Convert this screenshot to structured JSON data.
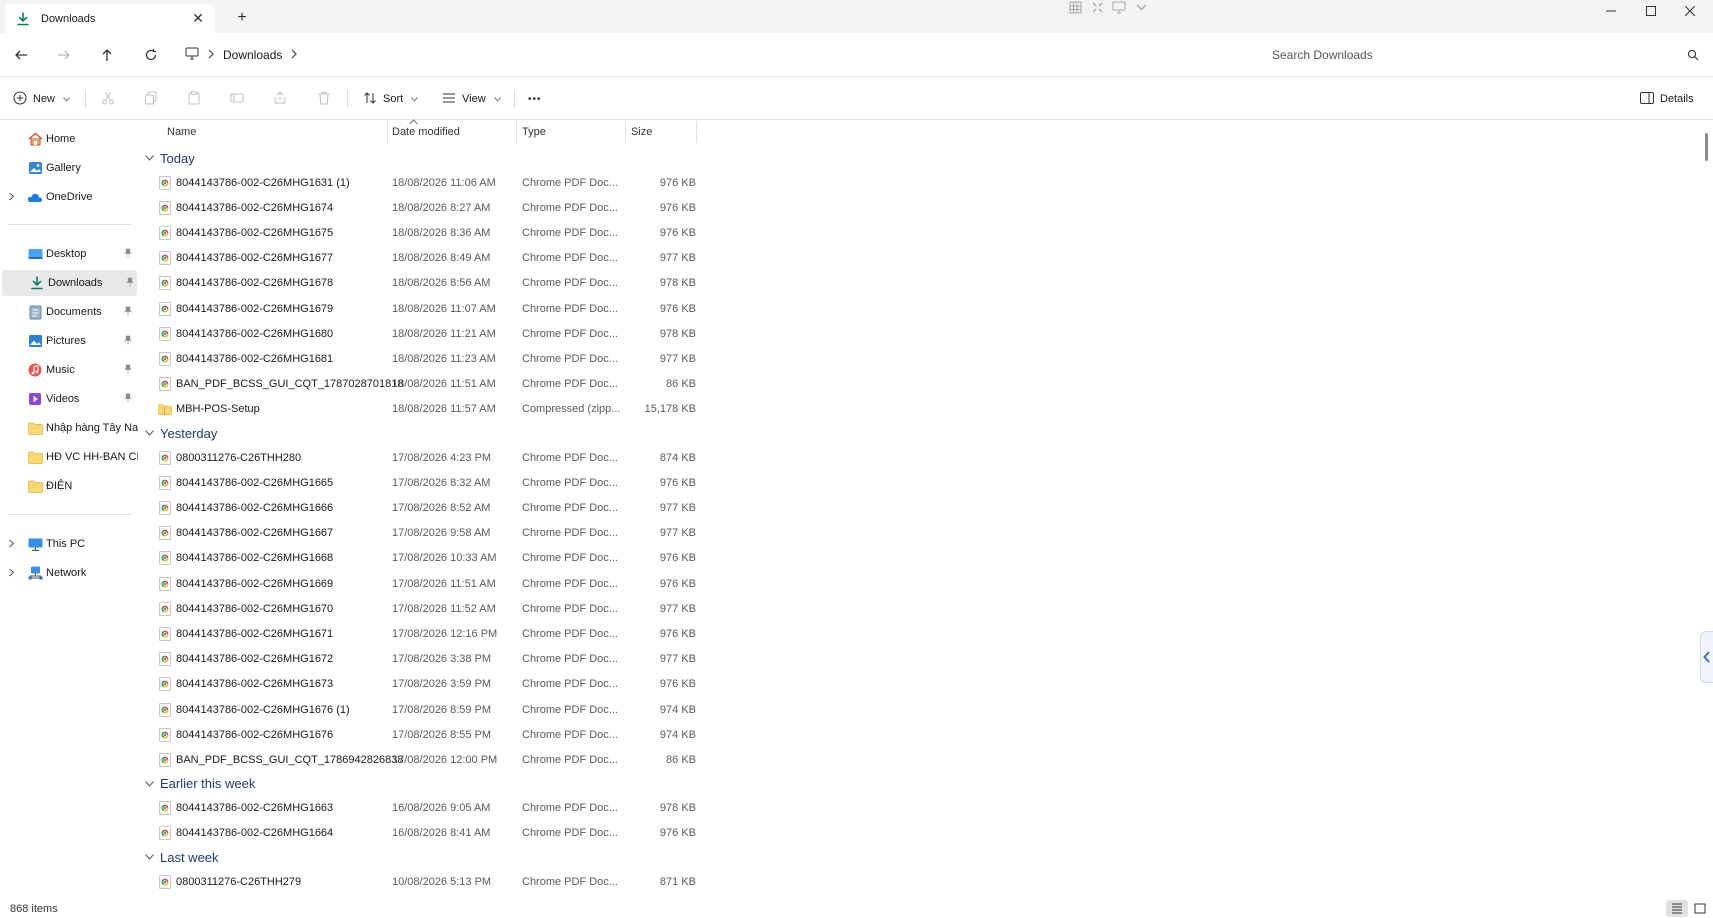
{
  "tab": {
    "icon": "download-icon",
    "title": "Downloads",
    "close": "✕",
    "new_tab": "+"
  },
  "window": {
    "minimize": "—",
    "maximize": "☐",
    "close": "✕"
  },
  "address": {
    "breadcrumbs": [
      "Downloads"
    ],
    "search_placeholder": "Search Downloads"
  },
  "toolbar": {
    "new_label": "New",
    "sort_label": "Sort",
    "view_label": "View",
    "more_label": "•••",
    "details_label": "Details"
  },
  "sidebar": {
    "quick": [
      {
        "label": "Home",
        "icon": "home-icon"
      },
      {
        "label": "Gallery",
        "icon": "gallery-icon"
      },
      {
        "label": "OneDrive",
        "icon": "onedrive-icon"
      }
    ],
    "pinned": [
      {
        "label": "Desktop",
        "icon": "desktop-folder-icon"
      },
      {
        "label": "Downloads",
        "icon": "downloads-folder-icon"
      },
      {
        "label": "Documents",
        "icon": "documents-folder-icon"
      },
      {
        "label": "Pictures",
        "icon": "pictures-folder-icon"
      },
      {
        "label": "Music",
        "icon": "music-folder-icon"
      },
      {
        "label": "Videos",
        "icon": "videos-folder-icon"
      },
      {
        "label": "Nhập hàng Tây Nam",
        "icon": "folder-icon"
      },
      {
        "label": "HĐ VC HH-BAN CHỈ",
        "icon": "folder-icon"
      },
      {
        "label": "ĐIỆN",
        "icon": "folder-icon"
      }
    ],
    "devices": [
      {
        "label": "This PC",
        "icon": "pc-icon"
      },
      {
        "label": "Network",
        "icon": "network-icon"
      }
    ]
  },
  "columns": {
    "name": "Name",
    "date": "Date modified",
    "type": "Type",
    "size": "Size"
  },
  "groups": [
    {
      "label": "Today",
      "rows": [
        {
          "name": "8044143786-002-C26MHG1631 (1)",
          "date": "18/08/2026 11:06 AM",
          "type": "Chrome PDF Doc...",
          "size": "976 KB",
          "icon": "chrome-pdf-icon"
        },
        {
          "name": "8044143786-002-C26MHG1674",
          "date": "18/08/2026 8:27 AM",
          "type": "Chrome PDF Doc...",
          "size": "976 KB",
          "icon": "chrome-pdf-icon"
        },
        {
          "name": "8044143786-002-C26MHG1675",
          "date": "18/08/2026 8:36 AM",
          "type": "Chrome PDF Doc...",
          "size": "976 KB",
          "icon": "chrome-pdf-icon"
        },
        {
          "name": "8044143786-002-C26MHG1677",
          "date": "18/08/2026 8:49 AM",
          "type": "Chrome PDF Doc...",
          "size": "977 KB",
          "icon": "chrome-pdf-icon"
        },
        {
          "name": "8044143786-002-C26MHG1678",
          "date": "18/08/2026 8:56 AM",
          "type": "Chrome PDF Doc...",
          "size": "978 KB",
          "icon": "chrome-pdf-icon"
        },
        {
          "name": "8044143786-002-C26MHG1679",
          "date": "18/08/2026 11:07 AM",
          "type": "Chrome PDF Doc...",
          "size": "976 KB",
          "icon": "chrome-pdf-icon"
        },
        {
          "name": "8044143786-002-C26MHG1680",
          "date": "18/08/2026 11:21 AM",
          "type": "Chrome PDF Doc...",
          "size": "978 KB",
          "icon": "chrome-pdf-icon"
        },
        {
          "name": "8044143786-002-C26MHG1681",
          "date": "18/08/2026 11:23 AM",
          "type": "Chrome PDF Doc...",
          "size": "977 KB",
          "icon": "chrome-pdf-icon"
        },
        {
          "name": "BAN_PDF_BCSS_GUI_CQT_1787028701818",
          "date": "18/08/2026 11:51 AM",
          "type": "Chrome PDF Doc...",
          "size": "86 KB",
          "icon": "chrome-pdf-icon"
        },
        {
          "name": "MBH-POS-Setup",
          "date": "18/08/2026 11:57 AM",
          "type": "Compressed (zipp...",
          "size": "15,178 KB",
          "icon": "zip-folder-icon"
        }
      ]
    },
    {
      "label": "Yesterday",
      "rows": [
        {
          "name": "0800311276-C26THH280",
          "date": "17/08/2026 4:23 PM",
          "type": "Chrome PDF Doc...",
          "size": "874 KB",
          "icon": "chrome-pdf-icon"
        },
        {
          "name": "8044143786-002-C26MHG1665",
          "date": "17/08/2026 8:32 AM",
          "type": "Chrome PDF Doc...",
          "size": "976 KB",
          "icon": "chrome-pdf-icon"
        },
        {
          "name": "8044143786-002-C26MHG1666",
          "date": "17/08/2026 8:52 AM",
          "type": "Chrome PDF Doc...",
          "size": "977 KB",
          "icon": "chrome-pdf-icon"
        },
        {
          "name": "8044143786-002-C26MHG1667",
          "date": "17/08/2026 9:58 AM",
          "type": "Chrome PDF Doc...",
          "size": "977 KB",
          "icon": "chrome-pdf-icon"
        },
        {
          "name": "8044143786-002-C26MHG1668",
          "date": "17/08/2026 10:33 AM",
          "type": "Chrome PDF Doc...",
          "size": "976 KB",
          "icon": "chrome-pdf-icon"
        },
        {
          "name": "8044143786-002-C26MHG1669",
          "date": "17/08/2026 11:51 AM",
          "type": "Chrome PDF Doc...",
          "size": "976 KB",
          "icon": "chrome-pdf-icon"
        },
        {
          "name": "8044143786-002-C26MHG1670",
          "date": "17/08/2026 11:52 AM",
          "type": "Chrome PDF Doc...",
          "size": "977 KB",
          "icon": "chrome-pdf-icon"
        },
        {
          "name": "8044143786-002-C26MHG1671",
          "date": "17/08/2026 12:16 PM",
          "type": "Chrome PDF Doc...",
          "size": "976 KB",
          "icon": "chrome-pdf-icon"
        },
        {
          "name": "8044143786-002-C26MHG1672",
          "date": "17/08/2026 3:38 PM",
          "type": "Chrome PDF Doc...",
          "size": "977 KB",
          "icon": "chrome-pdf-icon"
        },
        {
          "name": "8044143786-002-C26MHG1673",
          "date": "17/08/2026 3:59 PM",
          "type": "Chrome PDF Doc...",
          "size": "976 KB",
          "icon": "chrome-pdf-icon"
        },
        {
          "name": "8044143786-002-C26MHG1676 (1)",
          "date": "17/08/2026 8:59 PM",
          "type": "Chrome PDF Doc...",
          "size": "974 KB",
          "icon": "chrome-pdf-icon"
        },
        {
          "name": "8044143786-002-C26MHG1676",
          "date": "17/08/2026 8:55 PM",
          "type": "Chrome PDF Doc...",
          "size": "974 KB",
          "icon": "chrome-pdf-icon"
        },
        {
          "name": "BAN_PDF_BCSS_GUI_CQT_1786942826838",
          "date": "17/08/2026 12:00 PM",
          "type": "Chrome PDF Doc...",
          "size": "86 KB",
          "icon": "chrome-pdf-icon"
        }
      ]
    },
    {
      "label": "Earlier this week",
      "rows": [
        {
          "name": "8044143786-002-C26MHG1663",
          "date": "16/08/2026 9:05 AM",
          "type": "Chrome PDF Doc...",
          "size": "978 KB",
          "icon": "chrome-pdf-icon"
        },
        {
          "name": "8044143786-002-C26MHG1664",
          "date": "16/08/2026 8:41 AM",
          "type": "Chrome PDF Doc...",
          "size": "976 KB",
          "icon": "chrome-pdf-icon"
        }
      ]
    },
    {
      "label": "Last week",
      "rows": [
        {
          "name": "0800311276-C26THH279",
          "date": "10/08/2026 5:13 PM",
          "type": "Chrome PDF Doc...",
          "size": "871 KB",
          "icon": "chrome-pdf-icon"
        }
      ]
    }
  ],
  "status": {
    "count": "868 items"
  },
  "colors": {
    "accent": "#0f7b6c",
    "group_header": "#1f3b6e",
    "selected_bg": "#e8e8e8"
  }
}
